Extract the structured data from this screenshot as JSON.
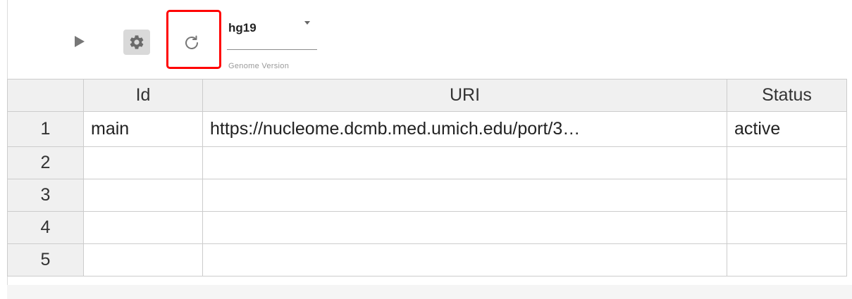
{
  "toolbar": {
    "play_icon": "play-icon",
    "settings_icon": "gear-icon",
    "refresh_icon": "refresh-icon",
    "genome": {
      "value": "hg19",
      "label": "Genome Version"
    }
  },
  "table": {
    "headers": {
      "rownum": "",
      "id": "Id",
      "uri": "URI",
      "status": "Status"
    },
    "rows": [
      {
        "n": "1",
        "id": "main",
        "uri": "https://nucleome.dcmb.med.umich.edu/port/3…",
        "status": "active"
      },
      {
        "n": "2",
        "id": "",
        "uri": "",
        "status": ""
      },
      {
        "n": "3",
        "id": "",
        "uri": "",
        "status": ""
      },
      {
        "n": "4",
        "id": "",
        "uri": "",
        "status": ""
      },
      {
        "n": "5",
        "id": "",
        "uri": "",
        "status": ""
      }
    ]
  },
  "colors": {
    "status_active": "#6dd62b",
    "highlight_box": "#ff0000",
    "header_bg": "#f0f0f0",
    "grid_line": "#cccccc"
  }
}
